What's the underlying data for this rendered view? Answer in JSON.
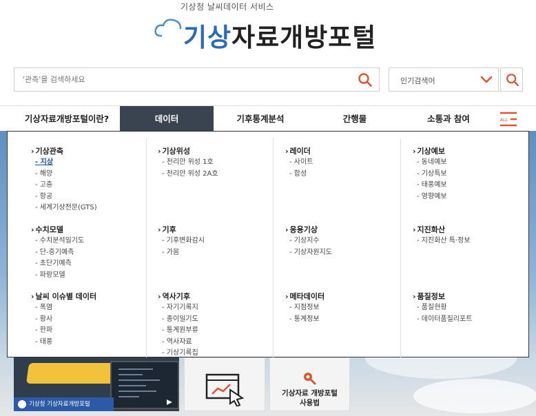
{
  "header": {
    "subtitle": "기상청 날씨데이터 서비스",
    "logo_blue": "기상",
    "logo_dark": "자료개방포털",
    "search_placeholder": "'관측'을 검색하세요",
    "popular_label": "인기검색어"
  },
  "nav": {
    "items": [
      {
        "label": "기상자료개방포털이란?"
      },
      {
        "label": "데이터"
      },
      {
        "label": "기후통계분석"
      },
      {
        "label": "간행물"
      },
      {
        "label": "소통과 참여"
      }
    ],
    "all_label": "ALL"
  },
  "mega_menu": {
    "groups": [
      {
        "title": "기상관측",
        "items": [
          "지상",
          "해양",
          "고층",
          "항공",
          "세계기상전문(GTS)"
        ]
      },
      {
        "title": "기상위성",
        "items": [
          "천리안 위성 1호",
          "천리안 위성 2A호"
        ]
      },
      {
        "title": "레이더",
        "items": [
          "사이트",
          "합성"
        ]
      },
      {
        "title": "기상예보",
        "items": [
          "동네예보",
          "기상특보",
          "태풍예보",
          "영향예보"
        ]
      },
      {
        "title": "수치모델",
        "items": [
          "수치분석일기도",
          "단-중기예측",
          "초단기예측",
          "파랑모델"
        ]
      },
      {
        "title": "기후",
        "items": [
          "기후변화감시",
          "가뭄"
        ]
      },
      {
        "title": "응용기상",
        "items": [
          "기상지수",
          "기상자원지도"
        ]
      },
      {
        "title": "지진화산",
        "items": [
          "지진화산 특·정보"
        ]
      },
      {
        "title": "날씨 이슈별 데이터",
        "items": [
          "폭염",
          "황사",
          "한파",
          "태풍"
        ]
      },
      {
        "title": "역사기후",
        "items": [
          "자기기록지",
          "종이일기도",
          "통계원부류",
          "역사자료",
          "기상기록집"
        ]
      },
      {
        "title": "메타데이터",
        "items": [
          "지점정보",
          "통계정보"
        ]
      },
      {
        "title": "품질정보",
        "items": [
          "품질현황",
          "데이터품질리포트"
        ]
      }
    ]
  },
  "cards": {
    "brand_label": "기상청 기상자료개방포털",
    "manual_label_line1": "기상자료 개방포털",
    "manual_label_line2": "사용법"
  },
  "colors": {
    "brand_blue": "#2b6cb8",
    "accent_orange": "#e2522b",
    "nav_active_bg": "#3a4350"
  }
}
